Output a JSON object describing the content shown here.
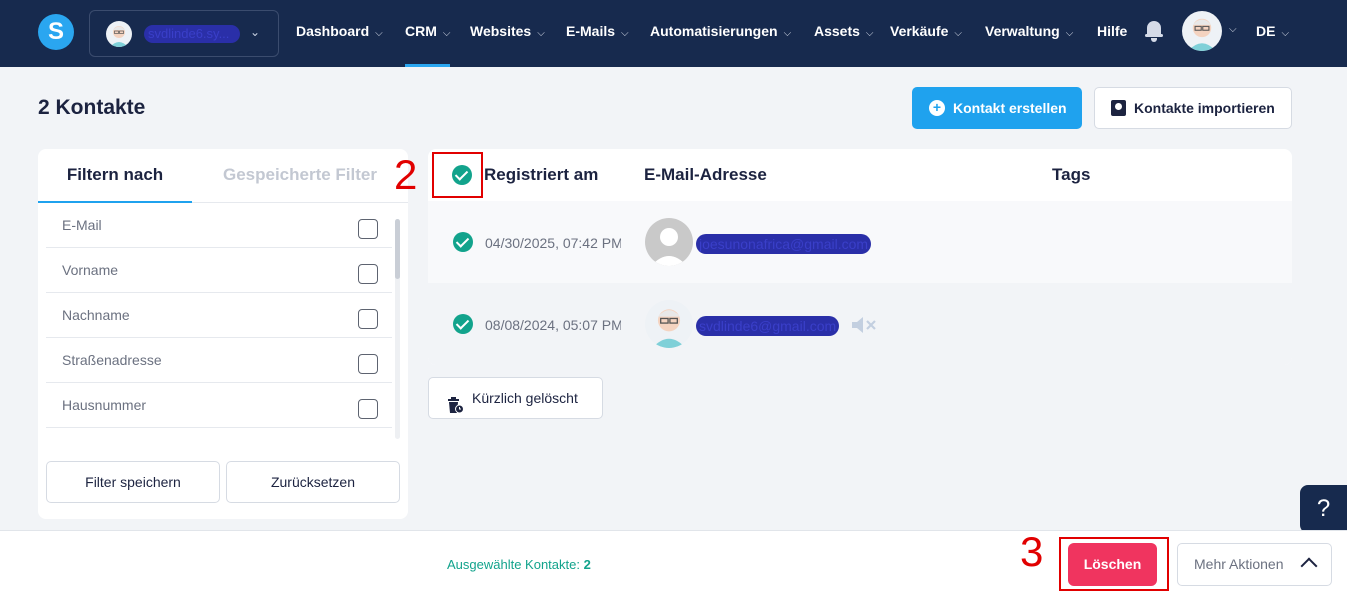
{
  "nav": {
    "logo": "S",
    "account_name": "svdlinde6.sy...",
    "items": [
      "Dashboard",
      "CRM",
      "Websites",
      "E-Mails",
      "Automatisierungen",
      "Assets",
      "Verkäufe",
      "Verwaltung"
    ],
    "help": "Hilfe",
    "language": "DE",
    "active": "CRM"
  },
  "header": {
    "title": "2 Kontakte",
    "create_button": "Kontakt erstellen",
    "import_button": "Kontakte importieren"
  },
  "filters": {
    "tab_active": "Filtern nach",
    "tab_inactive": "Gespeicherte Filter",
    "items": [
      "E-Mail",
      "Vorname",
      "Nachname",
      "Straßenadresse",
      "Hausnummer"
    ],
    "save_button": "Filter speichern",
    "reset_button": "Zurücksetzen"
  },
  "table": {
    "columns": [
      "Registriert am",
      "E-Mail-Adresse",
      "Tags"
    ],
    "rows": [
      {
        "date": "04/30/2025, 07:42 PM",
        "email": "joesunonafrica@gmail.com"
      },
      {
        "date": "08/08/2024, 05:07 PM",
        "email": "svdlinde6@gmail.com"
      }
    ]
  },
  "recently_deleted": "Kürzlich gelöscht",
  "help_button": "?",
  "footer": {
    "selected_label": "Ausgewählte Kontakte:",
    "selected_count": "2",
    "delete_button": "Löschen",
    "more_actions": "Mehr Aktionen"
  },
  "annotations": {
    "step_select": "2",
    "step_delete": "3"
  },
  "colors": {
    "nav_bg": "#172a4e",
    "accent": "#1fa2ee",
    "success": "#12a38c",
    "danger": "#f0345f",
    "annotation": "#e10000"
  }
}
